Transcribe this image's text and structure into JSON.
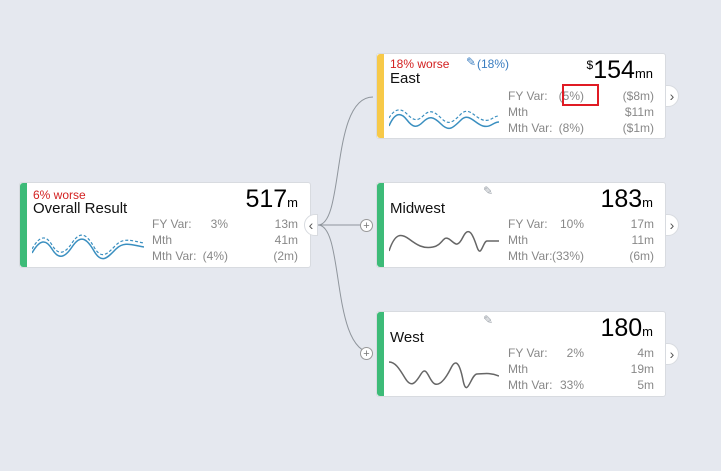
{
  "root": {
    "status": "6% worse",
    "label": "Overall Result",
    "value": "517",
    "unit": "m",
    "fy_var_label": "FY Var:",
    "fy_var_pct": "3%",
    "fy_var_val": "13m",
    "mth_label": "Mth",
    "mth_val": "41m",
    "mth_var_label": "Mth Var:",
    "mth_var_pct": "(4%)",
    "mth_var_val": "(2m)"
  },
  "east": {
    "status": "18% worse",
    "edit_pct": "(18%)",
    "label": "East",
    "prefix": "$",
    "value": "154",
    "unit": "mn",
    "fy_var_label": "FY Var:",
    "fy_var_pct": "(5%)",
    "fy_var_val": "($8m)",
    "mth_label": "Mth",
    "mth_val": "$11m",
    "mth_var_label": "Mth Var:",
    "mth_var_pct": "(8%)",
    "mth_var_val": "($1m)"
  },
  "midwest": {
    "label": "Midwest",
    "value": "183",
    "unit": "m",
    "fy_var_label": "FY Var:",
    "fy_var_pct": "10%",
    "fy_var_val": "17m",
    "mth_label": "Mth",
    "mth_val": "11m",
    "mth_var_label": "Mth Var:",
    "mth_var_pct": "(33%)",
    "mth_var_val": "(6m)"
  },
  "west": {
    "label": "West",
    "value": "180",
    "unit": "m",
    "fy_var_label": "FY Var:",
    "fy_var_pct": "2%",
    "fy_var_val": "4m",
    "mth_label": "Mth",
    "mth_val": "19m",
    "mth_var_label": "Mth Var:",
    "mth_var_pct": "33%",
    "mth_var_val": "5m"
  },
  "icons": {
    "collapse": "‹",
    "expand": "›",
    "plus": "+",
    "pencil": "✎"
  },
  "colors": {
    "good": "#3dbb78",
    "warning": "#f7c948",
    "bad_text": "#d32121",
    "spark_blue": "#3a8fc0",
    "spark_gray": "#666666"
  }
}
